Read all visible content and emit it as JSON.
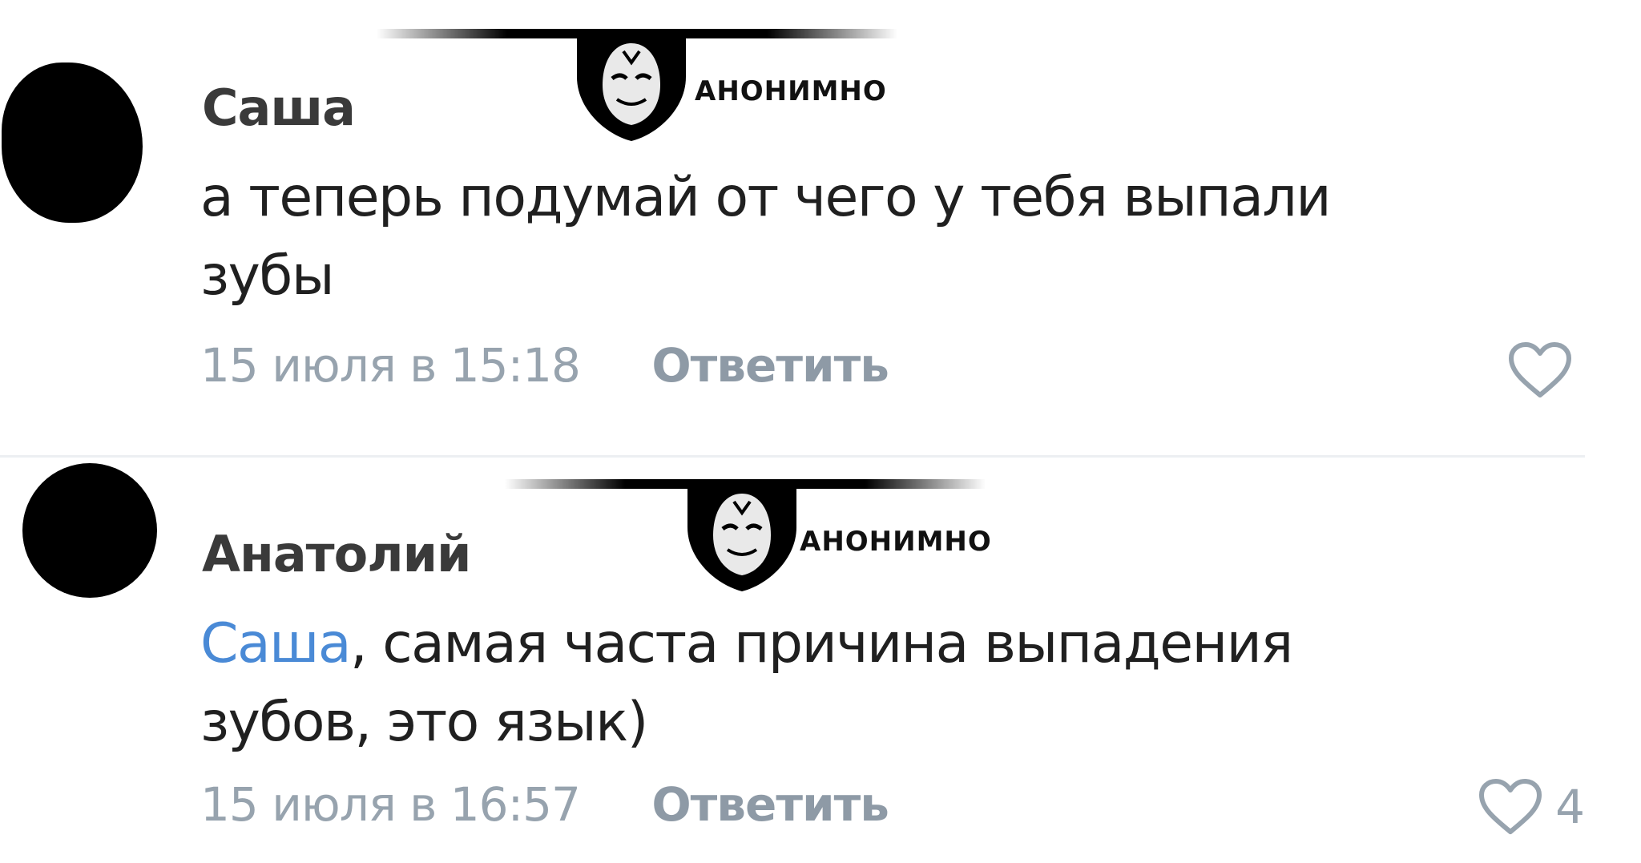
{
  "comments": [
    {
      "author": "Саша",
      "mention": "",
      "text": "а теперь подумай от чего у тебя выпали зубы",
      "date": "15 июля в 15:18",
      "reply_label": "Ответить",
      "like_count": ""
    },
    {
      "author": "Анатолий",
      "mention": "Саша",
      "text": ", самая часта причина выпадения зубов, это язык)",
      "date": "15 июля в 16:57",
      "reply_label": "Ответить",
      "like_count": "4"
    }
  ],
  "overlay": {
    "label": "АНОНИМНО"
  },
  "colors": {
    "mention": "#4a8ad6",
    "meta": "#97a3ae",
    "text": "#202020"
  },
  "icons": [
    "heart-icon",
    "anonymous-mask-icon"
  ]
}
